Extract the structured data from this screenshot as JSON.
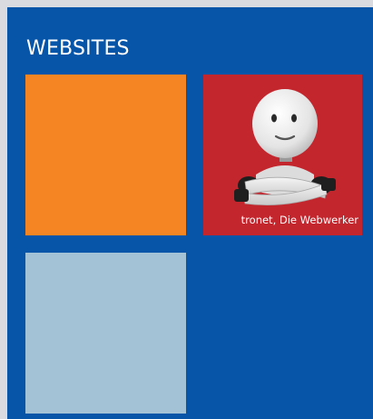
{
  "section": {
    "title": "WEBSITES"
  },
  "colors": {
    "background": "#0655a8",
    "tile_orange": "#f58523",
    "tile_red": "#c4262e",
    "tile_lightblue": "#a3c2d5"
  },
  "tiles": [
    {
      "label": "",
      "color": "#f58523"
    },
    {
      "label": "tronet, Die Webwerker",
      "color": "#c4262e",
      "image": "robot-mascot"
    },
    {
      "label": "",
      "color": "#a3c2d5"
    }
  ]
}
